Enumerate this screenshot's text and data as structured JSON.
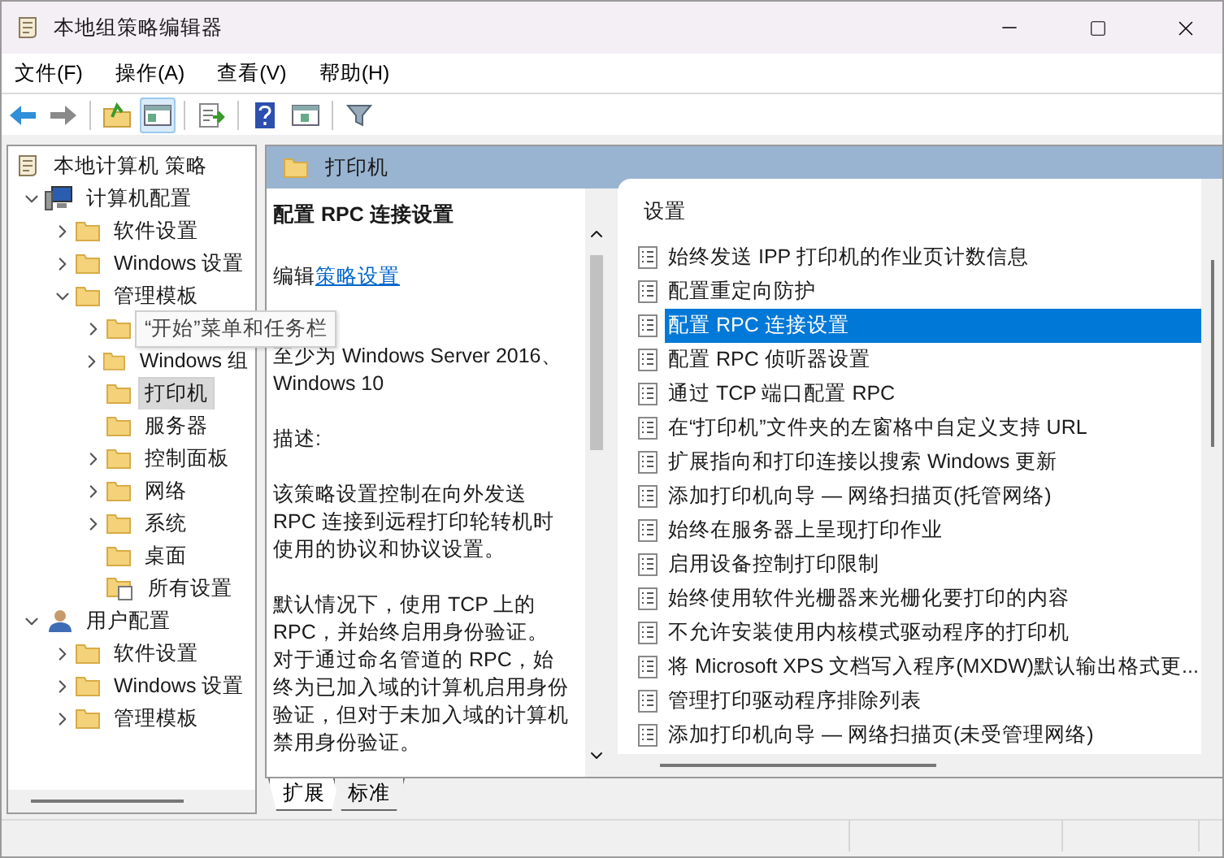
{
  "window": {
    "title": "本地组策略编辑器"
  },
  "menu": [
    {
      "label": "文件(F)"
    },
    {
      "label": "操作(A)"
    },
    {
      "label": "查看(V)"
    },
    {
      "label": "帮助(H)"
    }
  ],
  "toolbar": [
    {
      "kind": "back",
      "selected": false
    },
    {
      "kind": "forward",
      "selected": false
    },
    {
      "kind": "sep"
    },
    {
      "kind": "up",
      "selected": false
    },
    {
      "kind": "tree",
      "selected": true
    },
    {
      "kind": "sep"
    },
    {
      "kind": "export",
      "selected": false
    },
    {
      "kind": "sep"
    },
    {
      "kind": "help",
      "selected": false
    },
    {
      "kind": "pane",
      "selected": false
    },
    {
      "kind": "sep"
    },
    {
      "kind": "filter",
      "selected": false
    }
  ],
  "tree": {
    "root": "本地计算机 策略",
    "items": [
      {
        "label": "计算机配置",
        "kind": "computer",
        "expanded": true,
        "selected": false,
        "children": [
          {
            "label": "软件设置",
            "kind": "folder",
            "expanded": false,
            "selected": false
          },
          {
            "label": "Windows 设置",
            "kind": "folder",
            "expanded": false,
            "selected": false
          },
          {
            "label": "管理模板",
            "kind": "folder",
            "expanded": true,
            "selected": false,
            "children": [
              {
                "tooltip": "“开始”菜单和任务栏",
                "kind": "folder",
                "expanded": false,
                "selected": false
              },
              {
                "label": "Windows 组",
                "kind": "folder",
                "expanded": false,
                "selected": false
              },
              {
                "label": "打印机",
                "kind": "folder",
                "selected": true
              },
              {
                "label": "服务器",
                "kind": "folder",
                "selected": false
              },
              {
                "label": "控制面板",
                "kind": "folder",
                "expanded": false,
                "selected": false
              },
              {
                "label": "网络",
                "kind": "folder",
                "expanded": false,
                "selected": false
              },
              {
                "label": "系统",
                "kind": "folder",
                "expanded": false,
                "selected": false
              },
              {
                "label": "桌面",
                "kind": "folder",
                "selected": false
              },
              {
                "label": "所有设置",
                "kind": "settings",
                "selected": false
              }
            ]
          }
        ]
      },
      {
        "label": "用户配置",
        "kind": "user",
        "expanded": true,
        "selected": false,
        "children": [
          {
            "label": "软件设置",
            "kind": "folder",
            "expanded": false,
            "selected": false
          },
          {
            "label": "Windows 设置",
            "kind": "folder",
            "expanded": false,
            "selected": false
          },
          {
            "label": "管理模板",
            "kind": "folder",
            "expanded": false,
            "selected": false
          }
        ]
      }
    ]
  },
  "header": {
    "title": "打印机"
  },
  "description": {
    "title": "配置 RPC 连接设置",
    "edit_prefix": "编辑",
    "edit_link": "策略设置",
    "requirement": "至少为 Windows Server 2016、Windows 10",
    "paragraphs": [
      "描述:",
      "该策略设置控制在向外发送 RPC 连接到远程打印轮转机时使用的协议和协议设置。",
      "默认情况下，使用 TCP 上的 RPC，并始终启用身份验证。对于通过命名管道的 RPC，始终为已加入域的计算机启用身份验证，但对于未加入域的计算机禁用身份验证。"
    ]
  },
  "settings": {
    "column": "设置",
    "rows": [
      {
        "label": "始终发送 IPP 打印机的作业页计数信息",
        "selected": false
      },
      {
        "label": "配置重定向防护",
        "selected": false
      },
      {
        "label": "配置 RPC 连接设置",
        "selected": true
      },
      {
        "label": "配置 RPC 侦听器设置",
        "selected": false
      },
      {
        "label": "通过 TCP 端口配置 RPC",
        "selected": false
      },
      {
        "label": "在“打印机”文件夹的左窗格中自定义支持 URL",
        "selected": false
      },
      {
        "label": "扩展指向和打印连接以搜索 Windows 更新",
        "selected": false
      },
      {
        "label": "添加打印机向导 — 网络扫描页(托管网络)",
        "selected": false
      },
      {
        "label": "始终在服务器上呈现打印作业",
        "selected": false
      },
      {
        "label": "启用设备控制打印限制",
        "selected": false
      },
      {
        "label": "始终使用软件光栅器来光栅化要打印的内容",
        "selected": false
      },
      {
        "label": "不允许安装使用内核模式驱动程序的打印机",
        "selected": false
      },
      {
        "label": "将 Microsoft XPS 文档写入程序(MXDW)默认输出格式更...",
        "selected": false
      },
      {
        "label": "管理打印驱动程序排除列表",
        "selected": false
      },
      {
        "label": "添加打印机向导 — 网络扫描页(未受管理网络)",
        "selected": false
      }
    ]
  },
  "tabs": [
    {
      "label": "扩展",
      "selected": true
    },
    {
      "label": "标准",
      "selected": false
    }
  ]
}
